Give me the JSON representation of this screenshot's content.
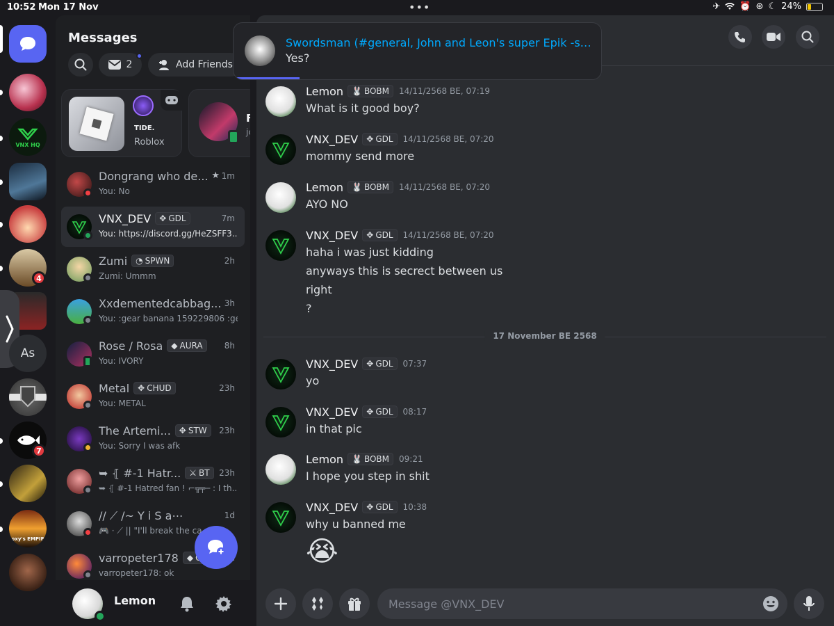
{
  "status_bar": {
    "time": "10:52",
    "date": "Mon 17 Nov",
    "battery": "24%",
    "battery_level": 0.24
  },
  "rail": {
    "server_badges": {
      "server_5": "4",
      "server_9": "7"
    },
    "text_server": "As",
    "labels": {
      "vnx": "VNX HQ",
      "empire": "oxy's EMPIF"
    }
  },
  "dm_panel": {
    "title": "Messages",
    "unread_count": "2",
    "add_friends": "Add Friends",
    "card_activity": {
      "user_label": "TIDE.",
      "game": "Roblox"
    },
    "card_partial_initial": "F",
    "card_partial_sub": "jc",
    "dms": [
      {
        "name": "Dongrang who de...",
        "tag": "",
        "tag_icon": "",
        "time": "1m",
        "preview": "You: No",
        "status": "dnd",
        "starred": true
      },
      {
        "name": "VNX_DEV",
        "tag": "GDL",
        "tag_icon": "✥",
        "time": "7m",
        "preview": "You: https://discord.gg/HeZSFF3...",
        "status": "online"
      },
      {
        "name": "Zumi",
        "tag": "SPWN",
        "tag_icon": "◔",
        "time": "2h",
        "preview": "Zumi: Ummm",
        "status": "offline"
      },
      {
        "name": "Xxdementedcabbag...",
        "tag": "",
        "tag_icon": "",
        "time": "3h",
        "preview": "You: :gear banana 159229806 :ge...",
        "status": "offline"
      },
      {
        "name": "Rose / Rosa",
        "tag": "AURA",
        "tag_icon": "◆",
        "time": "8h",
        "preview": "You: IVORY",
        "status": "mobile"
      },
      {
        "name": "Metal",
        "tag": "CHUD",
        "tag_icon": "✥",
        "time": "23h",
        "preview": "You: METAL",
        "status": "offline"
      },
      {
        "name": "The Artemi...",
        "tag": "STW",
        "tag_icon": "✥",
        "time": "23h",
        "preview": "You: Sorry I was afk",
        "status": "idle"
      },
      {
        "name": "➥ ⦃ #-1 Hatr...",
        "tag": "BT",
        "tag_icon": "⚔",
        "time": "23h",
        "preview": "➥ ⦃ #-1 Hatred fan ! ⌐╦╤─ : I th...",
        "status": "offline"
      },
      {
        "name": "// ⟋ /~ Y i  S a⋯",
        "tag": "",
        "tag_icon": "",
        "time": "1d",
        "preview": "🎮 · ⟋ || \"I'll break the ca",
        "status": "dnd"
      },
      {
        "name": "varropeter178",
        "tag": "GD",
        "tag_icon": "◆",
        "time": "1d",
        "preview": "varropeter178: ok",
        "status": "offline"
      }
    ],
    "current_user": "Lemon"
  },
  "notification": {
    "title": "Swordsman (#general, John and Leon's super Epik -sa...",
    "body": "Yes?",
    "progress": 0.18
  },
  "chat": {
    "date_divider": "17 November BE 2568",
    "composer_placeholder": "Message @VNX_DEV",
    "messages": [
      {
        "author": "Lemon",
        "tag": "BOBM",
        "tag_icon": "🐰",
        "time": "14/11/2568 BE, 07:19",
        "lines": [
          "What is it good boy?"
        ],
        "avatar": "lemon"
      },
      {
        "author": "VNX_DEV",
        "tag": "GDL",
        "tag_icon": "✥",
        "time": "14/11/2568 BE, 07:20",
        "lines": [
          "mommy send more"
        ],
        "avatar": "vnx"
      },
      {
        "author": "Lemon",
        "tag": "BOBM",
        "tag_icon": "🐰",
        "time": "14/11/2568 BE, 07:20",
        "lines": [
          "AYO NO"
        ],
        "avatar": "lemon"
      },
      {
        "author": "VNX_DEV",
        "tag": "GDL",
        "tag_icon": "✥",
        "time": "14/11/2568 BE, 07:20",
        "lines": [
          "haha i was just kidding",
          "anyways this is secrect between us",
          "right",
          "?"
        ],
        "avatar": "vnx"
      },
      {
        "author": "VNX_DEV",
        "tag": "GDL",
        "tag_icon": "✥",
        "time": "07:37",
        "lines": [
          "yo"
        ],
        "avatar": "vnx"
      },
      {
        "author": "VNX_DEV",
        "tag": "GDL",
        "tag_icon": "✥",
        "time": "08:17",
        "lines": [
          "in that  pic"
        ],
        "avatar": "vnx"
      },
      {
        "author": "Lemon",
        "tag": "BOBM",
        "tag_icon": "🐰",
        "time": "09:21",
        "lines": [
          "I hope you step in shit"
        ],
        "avatar": "lemon"
      },
      {
        "author": "VNX_DEV",
        "tag": "GDL",
        "tag_icon": "✥",
        "time": "10:38",
        "lines": [
          "why u banned me"
        ],
        "avatar": "vnx"
      }
    ],
    "last_emoji": "😭"
  },
  "colors": {
    "accent": "#5865f2",
    "online": "#23a55a",
    "dnd": "#f23f43",
    "idle": "#f0b232",
    "offline": "#80848e",
    "mention": "#00a8fc"
  },
  "icons": [
    "search-icon",
    "mail-icon",
    "add-friend-icon",
    "call-icon",
    "video-icon",
    "plus-icon",
    "apps-icon",
    "gift-icon",
    "emoji-icon",
    "mic-icon",
    "bell-icon",
    "gear-icon",
    "new-message-icon",
    "chevron-right-icon",
    "controller-icon"
  ]
}
